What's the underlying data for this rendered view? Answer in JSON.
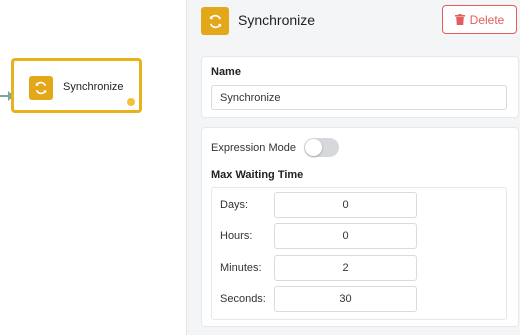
{
  "node": {
    "label": "Synchronize"
  },
  "panel": {
    "title": "Synchronize",
    "delete_label": "Delete",
    "name": {
      "label": "Name",
      "value": "Synchronize"
    },
    "expression_mode": {
      "label": "Expression Mode",
      "enabled": false
    },
    "max_waiting_time": {
      "label": "Max Waiting Time",
      "fields": [
        {
          "label": "Days:",
          "value": "0"
        },
        {
          "label": "Hours:",
          "value": "0"
        },
        {
          "label": "Minutes:",
          "value": "2"
        },
        {
          "label": "Seconds:",
          "value": "30"
        }
      ]
    }
  },
  "icons": {
    "node": "sync-icon",
    "header": "sync-icon",
    "delete": "trash-icon"
  },
  "colors": {
    "accent": "#e3a71a",
    "danger": "#e35d5d",
    "panel_bg": "#f4f5f7"
  }
}
